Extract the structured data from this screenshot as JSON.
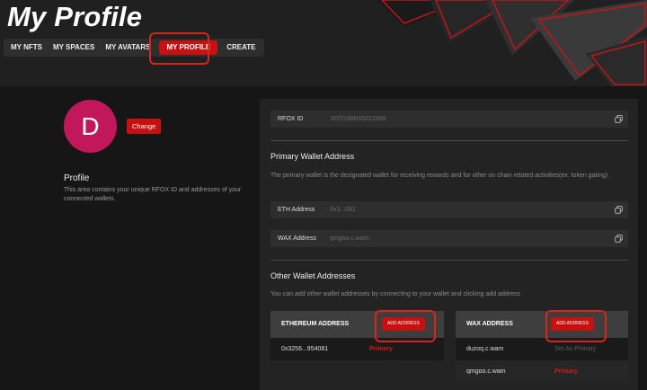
{
  "page": {
    "title": "My Profile"
  },
  "nav": {
    "tabs": [
      {
        "label": "MY NFTS"
      },
      {
        "label": "MY SPACES"
      },
      {
        "label": "MY AVATARS"
      },
      {
        "label": "MY PROFILE",
        "active": true
      },
      {
        "label": "CREATE"
      }
    ]
  },
  "profile": {
    "avatar_letter": "D",
    "change_label": "Change",
    "heading": "Profile",
    "description": "This area contains your unique RFOX ID and addresses of your connected wallets."
  },
  "rfox": {
    "label": "RFOX ID",
    "value": "1EFD3BE65223589"
  },
  "primary_wallet": {
    "heading": "Primary Wallet Address",
    "description": "The primary wallet is the designated wallet for receiving rewards and for other on chain related activities(ex. token gating).",
    "eth": {
      "label": "ETH Address",
      "value": "0x3...081"
    },
    "wax": {
      "label": "WAX Address",
      "value": "qmgoo.c.wam"
    }
  },
  "other_wallets": {
    "heading": "Other Wallet Addresses",
    "description": "You can add other wallet addresses by connecting to your wallet and clicking add address",
    "ethereum": {
      "header": "ETHEREUM ADDRESS",
      "add_label": "ADD ADDRESS",
      "rows": [
        {
          "address": "0x3256...954081",
          "status": "Primary"
        }
      ]
    },
    "wax": {
      "header": "WAX ADDRESS",
      "add_label": "ADD ADDRESS",
      "rows": [
        {
          "address": "duzoq.c.wam",
          "status": "Set As Primary"
        },
        {
          "address": "qmgoo.c.wam",
          "status": "Primary"
        }
      ]
    }
  },
  "colors": {
    "accent": "#c81010",
    "avatar": "#c2185b",
    "highlight_ring": "#d9231d"
  },
  "icons": {
    "copy": "copy-icon"
  }
}
